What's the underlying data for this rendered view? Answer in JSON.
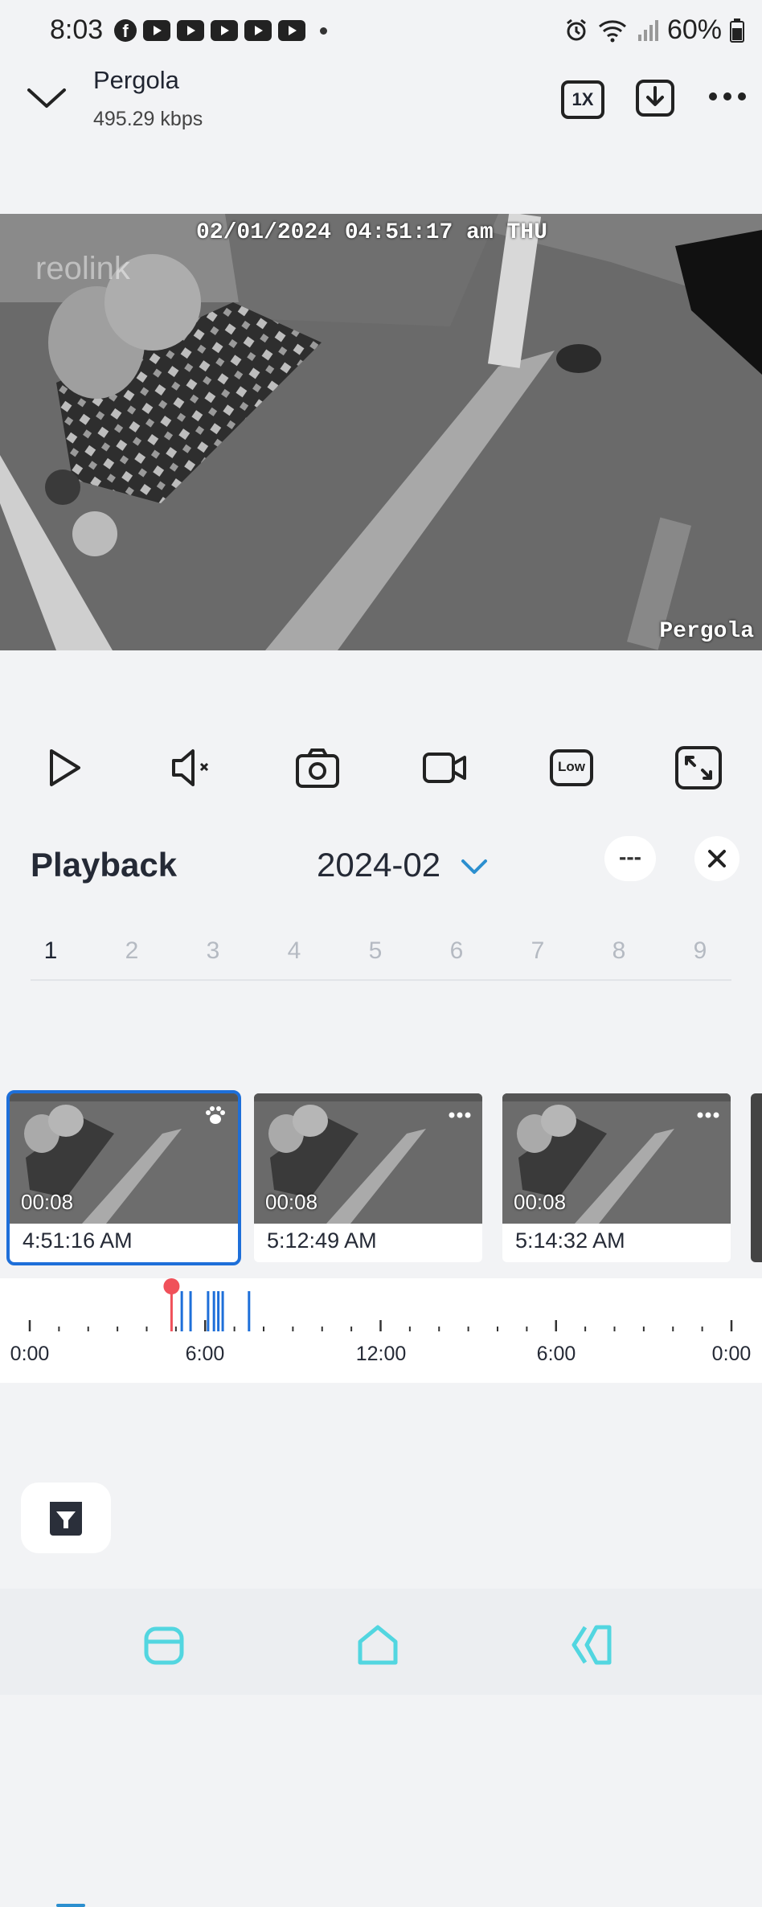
{
  "status_bar": {
    "time": "8:03",
    "battery": "60%",
    "icons": [
      "facebook-icon",
      "youtube-icon",
      "youtube-icon",
      "youtube-icon",
      "youtube-icon",
      "youtube-icon",
      "alarm-icon",
      "wifi-icon",
      "signal-icon",
      "battery-icon"
    ]
  },
  "header": {
    "title": "Pergola",
    "bitrate": "495.29 kbps",
    "speed_label": "1X"
  },
  "video": {
    "timestamp": "02/01/2024 04:51:17 am THU",
    "brand_watermark": "reolink",
    "camera_label": "Pergola"
  },
  "controls": [
    "play-icon",
    "mute-icon",
    "snapshot-icon",
    "record-icon",
    "quality-low-icon",
    "fullscreen-icon"
  ],
  "controls_quality_label": "Low",
  "playback": {
    "title": "Playback",
    "month": "2024-02",
    "dash_label": "---",
    "days": [
      "1",
      "2",
      "3",
      "4",
      "5",
      "6",
      "7",
      "8",
      "9"
    ],
    "selected_day": "1"
  },
  "clips": [
    {
      "duration": "00:08",
      "time": "4:51:16 AM",
      "selected": true,
      "badge": "paw-icon"
    },
    {
      "duration": "00:08",
      "time": "5:12:49 AM",
      "selected": false,
      "badge": "more-icon"
    },
    {
      "duration": "00:08",
      "time": "5:14:32 AM",
      "selected": false,
      "badge": "more-icon"
    }
  ],
  "timeline": {
    "labels": [
      "0:00",
      "6:00",
      "12:00",
      "6:00",
      "0:00"
    ],
    "playhead_hours": 4.85,
    "event_hours": [
      5.2,
      5.5,
      6.1,
      6.3,
      6.45,
      6.6,
      7.5
    ],
    "playhead_color": "#f0515a",
    "event_color": "#1e6fd9"
  },
  "nav": [
    "recent-apps-icon",
    "home-icon",
    "back-icon"
  ],
  "accent": "#2c8fcf"
}
